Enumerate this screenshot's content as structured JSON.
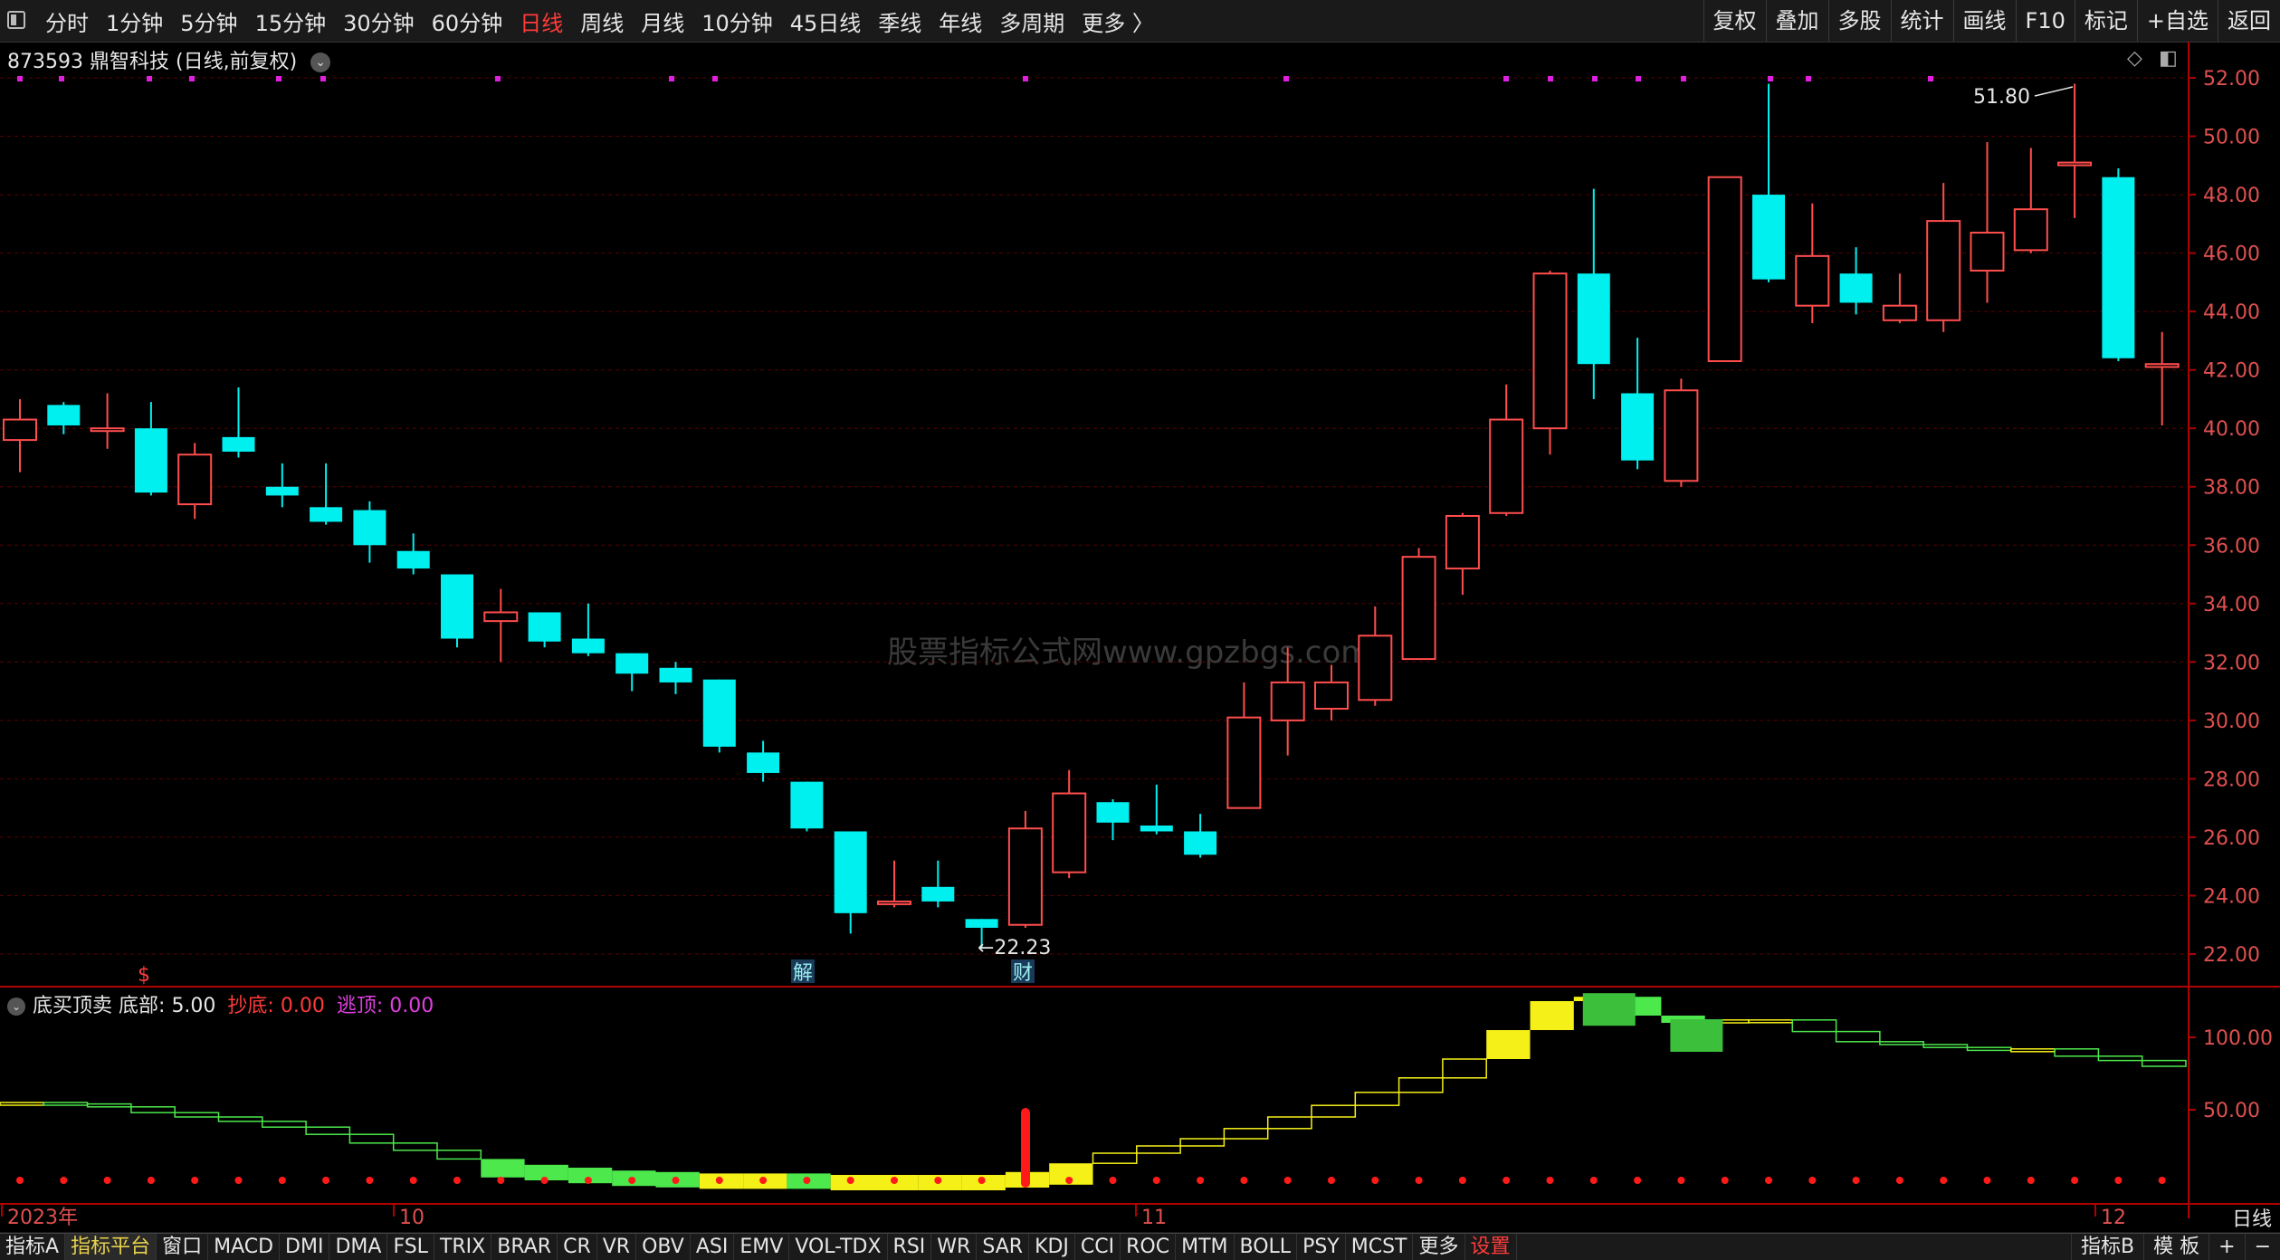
{
  "toolbar": {
    "periods": [
      "分时",
      "1分钟",
      "5分钟",
      "15分钟",
      "30分钟",
      "60分钟",
      "日线",
      "周线",
      "月线",
      "10分钟",
      "45日线",
      "季线",
      "年线",
      "多周期",
      "更多 〉"
    ],
    "active_period": "日线",
    "right_buttons": [
      "复权",
      "叠加",
      "多股",
      "统计",
      "画线",
      "F10",
      "标记",
      "+自选",
      "返回"
    ]
  },
  "stock": {
    "code": "873593",
    "name": "鼎智科技",
    "mode": "(日线,前复权)"
  },
  "price_axis": {
    "labels": [
      "52.00",
      "50.00",
      "48.00",
      "46.00",
      "44.00",
      "42.00",
      "40.00",
      "38.00",
      "36.00",
      "34.00",
      "32.00",
      "30.00",
      "28.00",
      "26.00",
      "24.00",
      "22.00"
    ]
  },
  "annotations": {
    "high": "51.80",
    "low": "←22.23",
    "marker_s": "$",
    "marker_jie": "解",
    "marker_cai": "财",
    "watermark": "股票指标公式网www.gpzbgs.com"
  },
  "indicator": {
    "name": "底买顶卖",
    "label_bottom": "底部:",
    "value_bottom": "5.00",
    "label_buy": "抄底:",
    "value_buy": "0.00",
    "label_sell": "逃顶:",
    "value_sell": "0.00",
    "axis_labels": [
      "100.00",
      "50.00"
    ]
  },
  "date_axis": {
    "labels": [
      "2023年",
      "10",
      "11",
      "12"
    ],
    "period_label": "日线"
  },
  "bottom_tabs": [
    "指标A",
    "指标平台",
    "窗口",
    "MACD",
    "DMI",
    "DMA",
    "FSL",
    "TRIX",
    "BRAR",
    "CR",
    "VR",
    "OBV",
    "ASI",
    "EMV",
    "VOL-TDX",
    "RSI",
    "WR",
    "SAR",
    "KDJ",
    "CCI",
    "ROC",
    "MTM",
    "BOLL",
    "PSY",
    "MCST",
    "更多",
    "设置"
  ],
  "bottom_right": [
    "指标B",
    "模 板",
    "+",
    "−"
  ],
  "colors": {
    "up": "#ff4d4d",
    "down": "#00f0f0",
    "grid": "#5a0000",
    "axis_text": "#e05050"
  },
  "chart_data": {
    "type": "candlestick",
    "title": "873593 鼎智科技 (日线,前复权)",
    "ylim": [
      21,
      53
    ],
    "candles": [
      {
        "o": 39.6,
        "c": 40.3,
        "h": 41.0,
        "l": 38.5
      },
      {
        "o": 40.8,
        "c": 40.1,
        "h": 40.9,
        "l": 39.8
      },
      {
        "o": 40.0,
        "c": 40.0,
        "h": 41.2,
        "l": 39.3
      },
      {
        "o": 40.0,
        "c": 37.8,
        "h": 40.9,
        "l": 37.7
      },
      {
        "o": 37.4,
        "c": 39.1,
        "h": 39.5,
        "l": 36.9
      },
      {
        "o": 39.7,
        "c": 39.2,
        "h": 41.4,
        "l": 39.0
      },
      {
        "o": 38.0,
        "c": 37.7,
        "h": 38.8,
        "l": 37.3
      },
      {
        "o": 37.3,
        "c": 36.8,
        "h": 38.8,
        "l": 36.7
      },
      {
        "o": 37.2,
        "c": 36.0,
        "h": 37.5,
        "l": 35.4
      },
      {
        "o": 35.8,
        "c": 35.2,
        "h": 36.4,
        "l": 35.0
      },
      {
        "o": 35.0,
        "c": 32.8,
        "h": 35.0,
        "l": 32.5
      },
      {
        "o": 33.4,
        "c": 33.7,
        "h": 34.5,
        "l": 32.0
      },
      {
        "o": 33.7,
        "c": 32.7,
        "h": 33.7,
        "l": 32.5
      },
      {
        "o": 32.8,
        "c": 32.3,
        "h": 34.0,
        "l": 32.2
      },
      {
        "o": 32.3,
        "c": 31.6,
        "h": 32.3,
        "l": 31.0
      },
      {
        "o": 31.8,
        "c": 31.3,
        "h": 32.0,
        "l": 30.9
      },
      {
        "o": 31.4,
        "c": 29.1,
        "h": 31.4,
        "l": 28.9
      },
      {
        "o": 28.9,
        "c": 28.2,
        "h": 29.3,
        "l": 27.9
      },
      {
        "o": 27.9,
        "c": 26.3,
        "h": 27.9,
        "l": 26.2
      },
      {
        "o": 26.2,
        "c": 23.4,
        "h": 26.2,
        "l": 22.7
      },
      {
        "o": 23.8,
        "c": 23.8,
        "h": 25.2,
        "l": 23.6
      },
      {
        "o": 24.3,
        "c": 23.8,
        "h": 25.2,
        "l": 23.6
      },
      {
        "o": 23.2,
        "c": 22.9,
        "h": 23.2,
        "l": 22.23
      },
      {
        "o": 23.0,
        "c": 26.3,
        "h": 26.9,
        "l": 22.9
      },
      {
        "o": 24.8,
        "c": 27.5,
        "h": 28.3,
        "l": 24.6
      },
      {
        "o": 27.2,
        "c": 26.5,
        "h": 27.3,
        "l": 25.9
      },
      {
        "o": 26.4,
        "c": 26.2,
        "h": 27.8,
        "l": 26.1
      },
      {
        "o": 26.2,
        "c": 25.4,
        "h": 26.8,
        "l": 25.3
      },
      {
        "o": 27.0,
        "c": 30.1,
        "h": 31.3,
        "l": 27.0
      },
      {
        "o": 30.0,
        "c": 31.3,
        "h": 32.5,
        "l": 28.8
      },
      {
        "o": 30.4,
        "c": 31.3,
        "h": 31.9,
        "l": 30.0
      },
      {
        "o": 30.7,
        "c": 32.9,
        "h": 33.9,
        "l": 30.5
      },
      {
        "o": 32.1,
        "c": 35.6,
        "h": 35.9,
        "l": 32.1
      },
      {
        "o": 35.2,
        "c": 37.0,
        "h": 37.1,
        "l": 34.3
      },
      {
        "o": 37.1,
        "c": 40.3,
        "h": 41.5,
        "l": 37.0
      },
      {
        "o": 40.0,
        "c": 45.3,
        "h": 45.4,
        "l": 39.1
      },
      {
        "o": 45.3,
        "c": 42.2,
        "h": 48.2,
        "l": 41.0
      },
      {
        "o": 41.2,
        "c": 38.9,
        "h": 43.1,
        "l": 38.6
      },
      {
        "o": 38.2,
        "c": 41.3,
        "h": 41.7,
        "l": 38.0
      },
      {
        "o": 42.3,
        "c": 48.6,
        "h": 48.6,
        "l": 42.3
      },
      {
        "o": 48.0,
        "c": 45.1,
        "h": 51.8,
        "l": 45.0
      },
      {
        "o": 44.2,
        "c": 45.9,
        "h": 47.7,
        "l": 43.6
      },
      {
        "o": 45.3,
        "c": 44.3,
        "h": 46.2,
        "l": 43.9
      },
      {
        "o": 43.7,
        "c": 44.2,
        "h": 45.3,
        "l": 43.6
      },
      {
        "o": 43.7,
        "c": 47.1,
        "h": 48.4,
        "l": 43.3
      },
      {
        "o": 45.4,
        "c": 46.7,
        "h": 49.8,
        "l": 44.3
      },
      {
        "o": 46.1,
        "c": 47.5,
        "h": 49.6,
        "l": 46.0
      },
      {
        "o": 49.1,
        "c": 49.1,
        "h": 51.8,
        "l": 47.2
      },
      {
        "o": 48.6,
        "c": 42.4,
        "h": 48.9,
        "l": 42.3
      },
      {
        "o": 42.1,
        "c": 42.2,
        "h": 43.3,
        "l": 40.1
      }
    ],
    "indicator_series": {
      "name": "底买顶卖",
      "step_values": [
        55,
        54,
        52,
        48,
        45,
        42,
        38,
        33,
        27,
        22,
        16,
        12,
        10,
        8,
        7,
        6,
        6,
        6,
        5,
        5,
        5,
        5,
        5,
        7,
        13,
        20,
        25,
        30,
        37,
        45,
        53,
        62,
        72,
        85,
        105,
        125,
        128,
        115,
        110,
        112,
        112,
        104,
        97,
        95,
        93,
        91,
        92,
        87,
        84,
        80
      ],
      "ylim": [
        0,
        160
      ]
    }
  }
}
